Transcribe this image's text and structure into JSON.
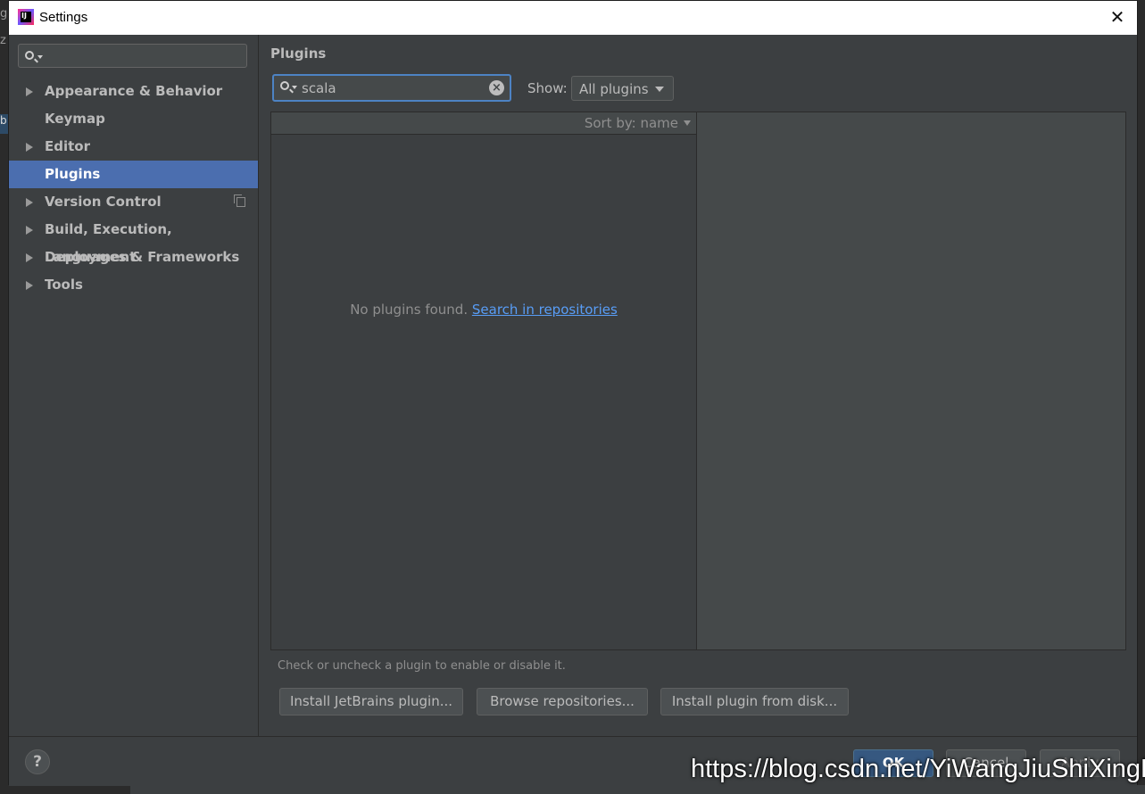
{
  "window": {
    "title": "Settings"
  },
  "background_fragments": [
    "g",
    "z",
    "b"
  ],
  "sidebar": {
    "search_placeholder": "",
    "items": [
      {
        "label": "Appearance & Behavior",
        "has_arrow": true
      },
      {
        "label": "Keymap",
        "has_arrow": false
      },
      {
        "label": "Editor",
        "has_arrow": true
      },
      {
        "label": "Plugins",
        "has_arrow": false,
        "selected": true
      },
      {
        "label": "Version Control",
        "has_arrow": true,
        "project_icon": "copy-icon"
      },
      {
        "label": "Build, Execution, Deployment",
        "has_arrow": true
      },
      {
        "label": "Languages & Frameworks",
        "has_arrow": true
      },
      {
        "label": "Tools",
        "has_arrow": true
      }
    ]
  },
  "plugins": {
    "title": "Plugins",
    "search_value": "scala",
    "show_label": "Show:",
    "show_value": "All plugins",
    "sort_label": "Sort by: name",
    "empty_text": "No plugins found.",
    "empty_link": "Search in repositories",
    "hint": "Check or uncheck a plugin to enable or disable it.",
    "buttons": {
      "install_jetbrains": "Install JetBrains plugin...",
      "browse": "Browse repositories...",
      "install_disk": "Install plugin from disk..."
    }
  },
  "footer": {
    "help": "?",
    "ok": "OK",
    "cancel": "Cancel",
    "apply": "Apply"
  },
  "watermark": "https://blog.csdn.net/YiWangJiuShiXingFu",
  "colors": {
    "background": "#3c3f41",
    "selection": "#4b6eaf",
    "focus_border": "#4d83c4",
    "link": "#589df6",
    "default_button": "#365880"
  }
}
